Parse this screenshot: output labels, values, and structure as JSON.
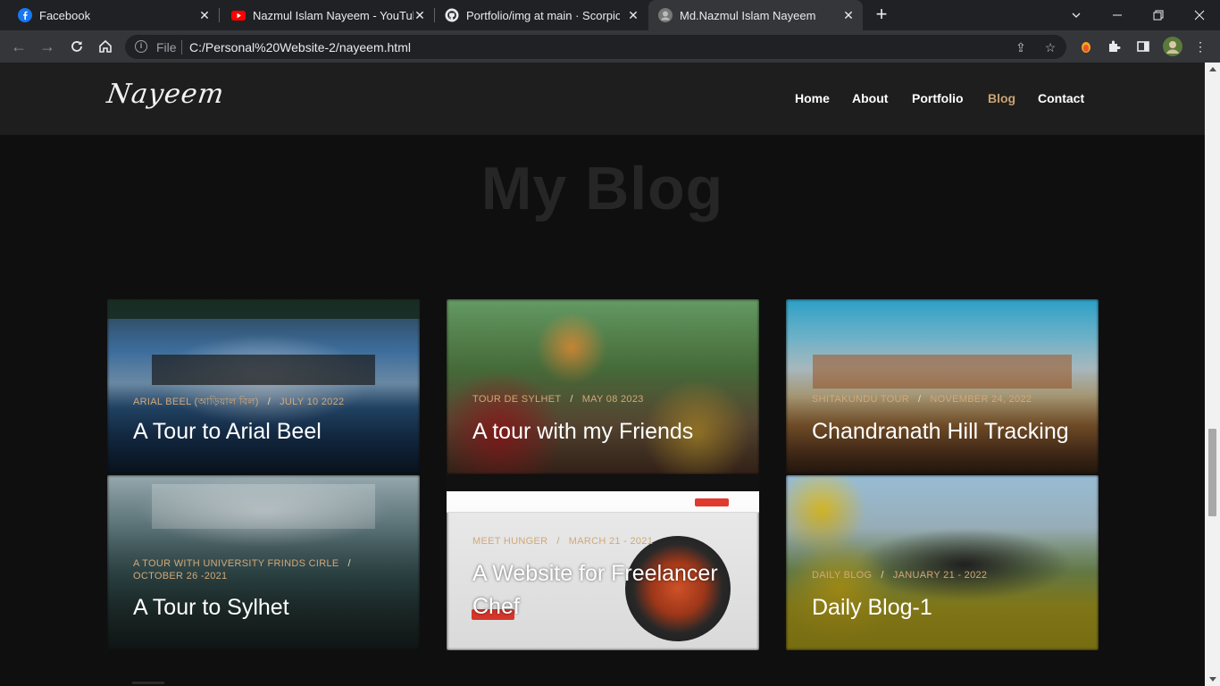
{
  "browser": {
    "tabs": [
      {
        "title": "Facebook",
        "icon": "facebook-icon"
      },
      {
        "title": "Nazmul Islam Nayeem - YouTube",
        "icon": "youtube-icon"
      },
      {
        "title": "Portfolio/img at main · ScorpionN",
        "icon": "github-icon"
      },
      {
        "title": "Md.Nazmul Islam Nayeem",
        "icon": "avatar-icon"
      }
    ],
    "address": {
      "scheme_label": "File",
      "url": "C:/Personal%20Website-2/nayeem.html"
    }
  },
  "site": {
    "logo": "Nayeem",
    "nav": [
      "Home",
      "About",
      "Portfolio",
      "Blog",
      "Contact"
    ],
    "active_nav": "Blog",
    "accent_color": "#c9a371",
    "section_title": "My Blog"
  },
  "posts": [
    {
      "category": "ARIAL BEEL (আড়িয়াল বিল)",
      "date": "JULY 10 2022",
      "title": "A Tour to Arial Beel"
    },
    {
      "category": "TOUR DE SYLHET",
      "date": "MAY 08 2023",
      "title": "A tour with my Friends"
    },
    {
      "category": "SHITAKUNDU TOUR",
      "date": "NOVEMBER 24, 2022",
      "title": "Chandranath Hill Tracking"
    },
    {
      "category": "A TOUR WITH UNIVERSITY FRINDS CIRLE",
      "date": "OCTOBER 26 -2021",
      "title": "A Tour to Sylhet"
    },
    {
      "category": "MEET HUNGER",
      "date": "MARCH 21 - 2021",
      "title": "A Website for Freelancer Chef"
    },
    {
      "category": "DAILY BLOG",
      "date": "JANUARY 21 - 2022",
      "title": "Daily Blog-1"
    }
  ]
}
